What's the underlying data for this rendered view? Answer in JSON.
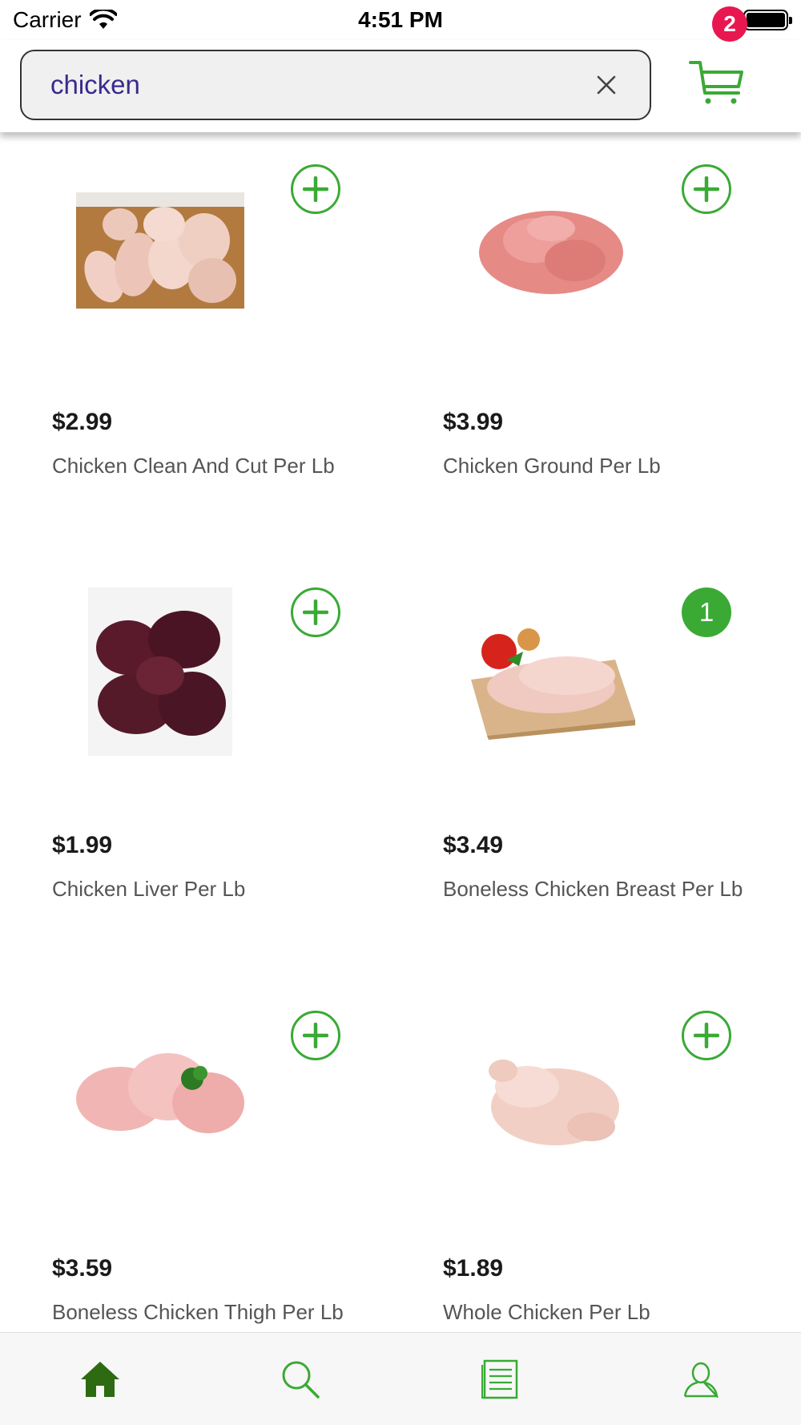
{
  "status_bar": {
    "carrier": "Carrier",
    "time": "4:51 PM"
  },
  "search": {
    "value": "chicken"
  },
  "cart": {
    "count": "2"
  },
  "colors": {
    "accent": "#3aaa35",
    "badge": "#e8174f",
    "search_text": "#3a2a8c",
    "tab_active": "#2d6a12"
  },
  "products": [
    {
      "price": "$2.99",
      "name": "Chicken Clean And Cut Per Lb",
      "image": "chicken-cut-pieces",
      "in_cart": null
    },
    {
      "price": "$3.99",
      "name": "Chicken Ground Per Lb",
      "image": "ground-chicken",
      "in_cart": null
    },
    {
      "price": "$1.99",
      "name": "Chicken Liver Per Lb",
      "image": "chicken-liver",
      "in_cart": null
    },
    {
      "price": "$3.49",
      "name": "Boneless Chicken Breast Per Lb",
      "image": "chicken-breast-on-board",
      "in_cart": "1"
    },
    {
      "price": "$3.59",
      "name": "Boneless Chicken Thigh Per Lb",
      "image": "chicken-thighs",
      "in_cart": null
    },
    {
      "price": "$1.89",
      "name": "Whole Chicken Per Lb",
      "image": "whole-chicken",
      "in_cart": null
    }
  ],
  "tabs": [
    {
      "icon": "home-icon",
      "active": true
    },
    {
      "icon": "search-icon",
      "active": false
    },
    {
      "icon": "orders-icon",
      "active": false
    },
    {
      "icon": "profile-icon",
      "active": false
    }
  ]
}
